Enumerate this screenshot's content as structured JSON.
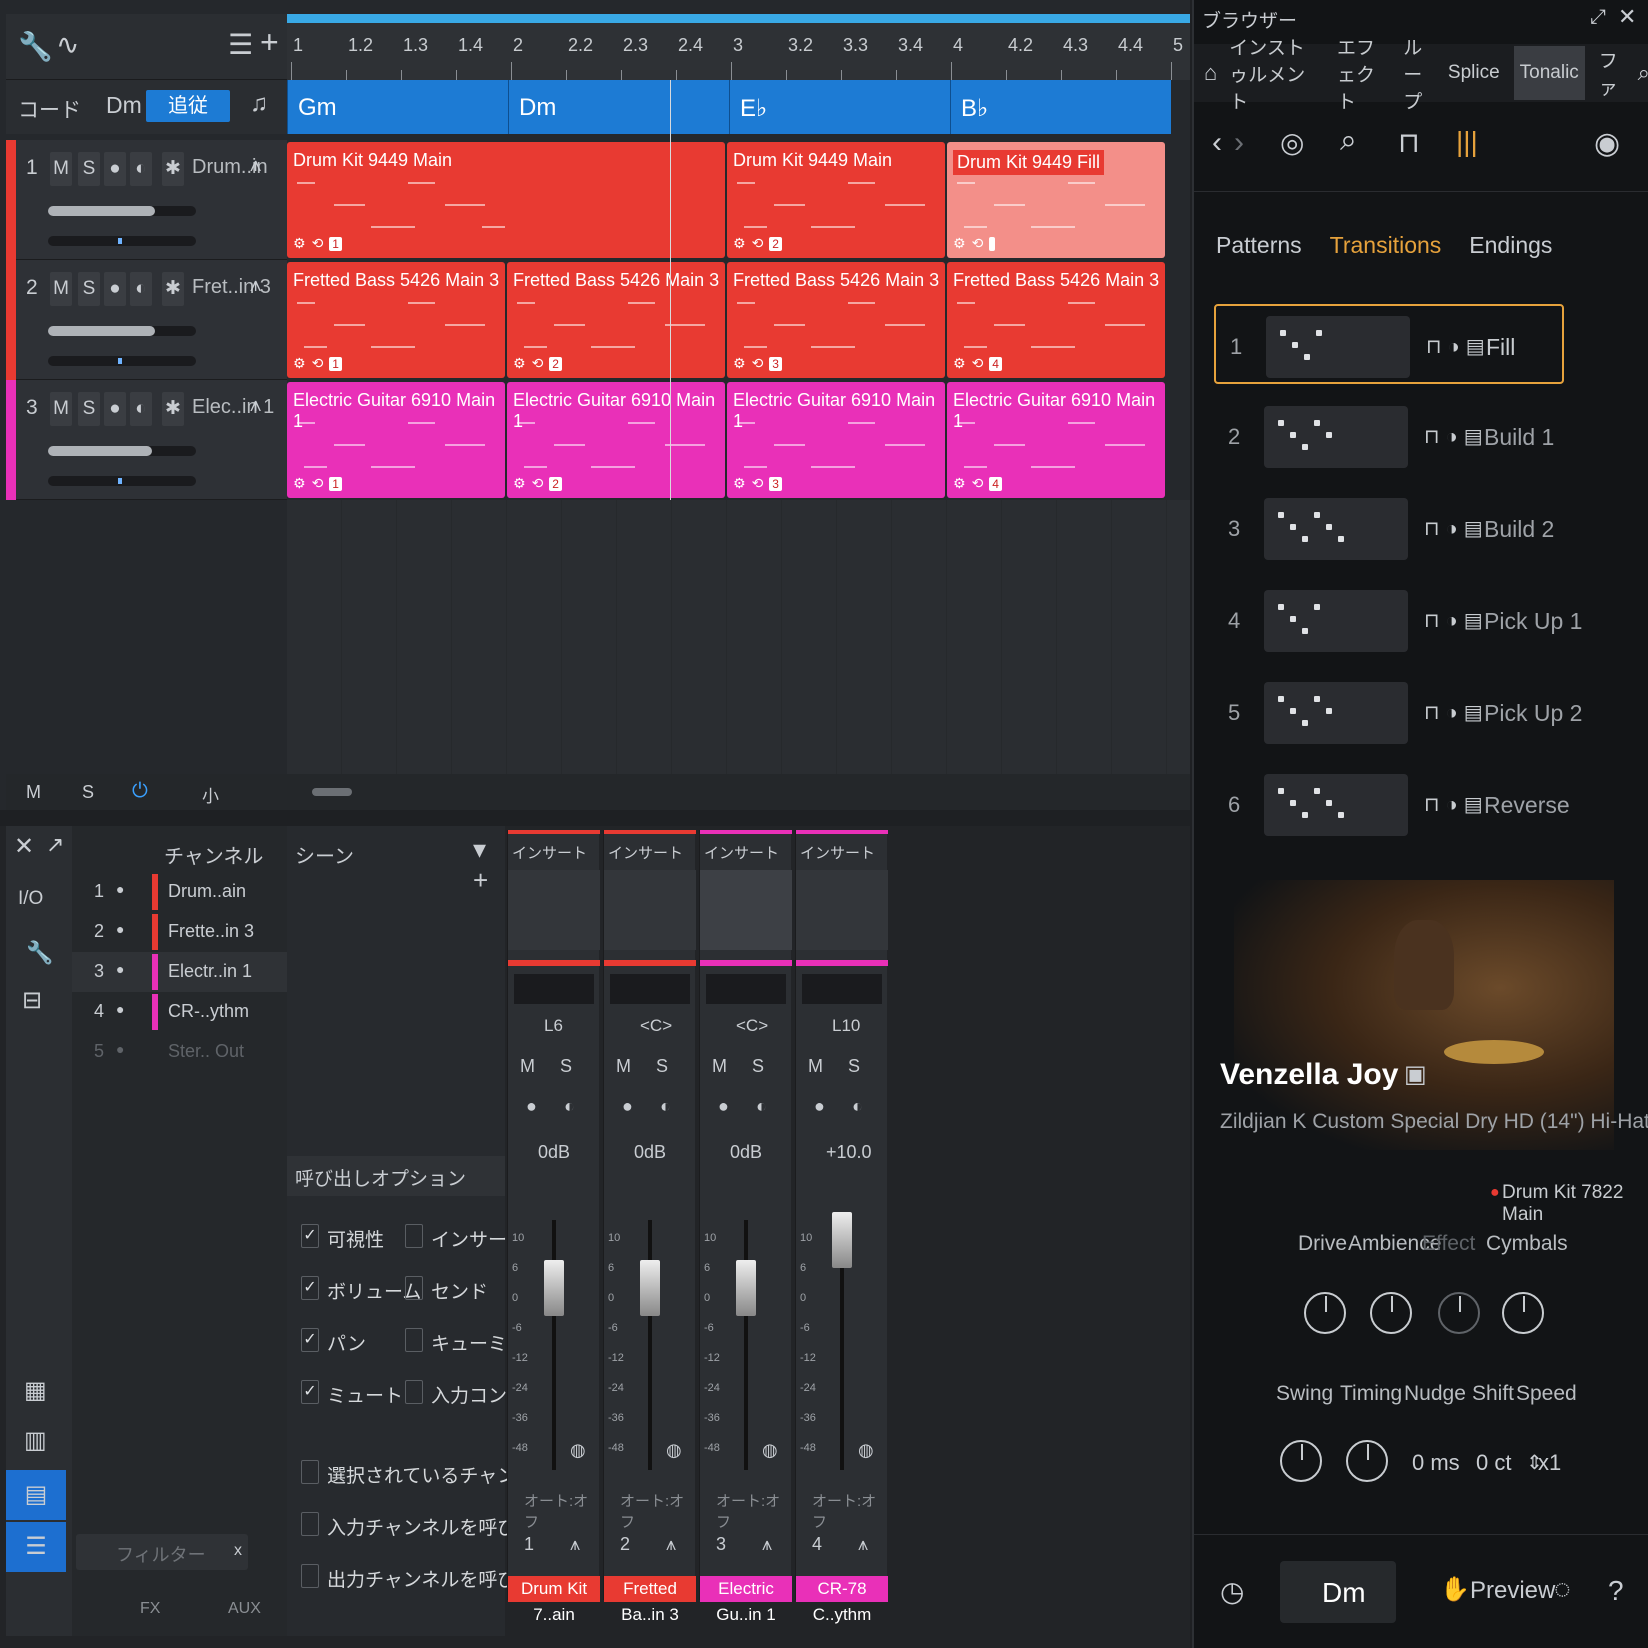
{
  "arrange": {
    "ruler_marks": [
      "1",
      "1.2",
      "1.3",
      "1.4",
      "2",
      "2.2",
      "2.3",
      "2.4",
      "3",
      "3.2",
      "3.3",
      "3.4",
      "4",
      "4.2",
      "4.3",
      "4.4",
      "5"
    ],
    "chord_header": {
      "label": "コード",
      "key": "Dm",
      "follow_button": "追従"
    },
    "chords": [
      "Gm",
      "Dm",
      "E♭",
      "B♭"
    ],
    "tracks": [
      {
        "num": "1",
        "name": "Drum..in",
        "color": "#e83a32",
        "clips": [
          {
            "title": "Drum Kit 9449 Main",
            "badge": "1"
          },
          {
            "title": "Drum Kit 9449 Main",
            "badge": "2"
          },
          {
            "title": "Drum Kit 9449 Fill",
            "badge": ""
          }
        ]
      },
      {
        "num": "2",
        "name": "Fret..in 3",
        "color": "#e83a32",
        "clips": [
          {
            "title": "Fretted Bass 5426 Main 3",
            "badge": "1"
          },
          {
            "title": "Fretted Bass 5426 Main 3",
            "badge": "2"
          },
          {
            "title": "Fretted Bass 5426 Main 3",
            "badge": "3"
          },
          {
            "title": "Fretted Bass 5426 Main 3",
            "badge": "4"
          }
        ]
      },
      {
        "num": "3",
        "name": "Elec..in 1",
        "color": "#e930b8",
        "clips": [
          {
            "title": "Electric Guitar 6910 Main 1",
            "badge": "1"
          },
          {
            "title": "Electric Guitar 6910 Main 1",
            "badge": "2"
          },
          {
            "title": "Electric Guitar 6910 Main 1",
            "badge": "3"
          },
          {
            "title": "Electric Guitar 6910 Main 1",
            "badge": "4"
          }
        ]
      }
    ],
    "footer": {
      "m": "M",
      "s": "S",
      "size": "小"
    }
  },
  "mixer": {
    "left_labels": {
      "io": "I/O"
    },
    "channel_header": "チャンネル",
    "channels": [
      {
        "num": "1",
        "name": "Drum..ain",
        "color": "#e83a32"
      },
      {
        "num": "2",
        "name": "Frette..in 3",
        "color": "#e83a32"
      },
      {
        "num": "3",
        "name": "Electr..in 1",
        "color": "#e930b8"
      },
      {
        "num": "4",
        "name": "CR-..ythm",
        "color": "#e930b8"
      },
      {
        "num": "5",
        "name": "Ster.. Out",
        "color": ""
      }
    ],
    "scene_header": "シーン",
    "recall_title": "呼び出しオプション",
    "options": [
      {
        "label": "可視性",
        "checked": true
      },
      {
        "label": "インサート",
        "checked": false
      },
      {
        "label": "ボリューム",
        "checked": true
      },
      {
        "label": "センド",
        "checked": false
      },
      {
        "label": "パン",
        "checked": true
      },
      {
        "label": "キューミックス",
        "checked": false
      },
      {
        "label": "ミュート",
        "checked": true
      },
      {
        "label": "入力コントロー",
        "checked": false
      }
    ],
    "bottom_options": [
      "選択されているチャンネルのみ",
      "入力チャンネルを呼び出す",
      "出力チャンネルを呼び出す"
    ],
    "filter_placeholder": "フィルター",
    "bottom_tabs": [
      "FX",
      "AUX"
    ],
    "strips": [
      {
        "insert": "インサート",
        "pan": "L6",
        "db": "0dB",
        "auto": "オート:オフ",
        "num": "1",
        "name": "Drum Kit 7..ain",
        "color": "#e83a32"
      },
      {
        "insert": "インサート",
        "pan": "<C>",
        "db": "0dB",
        "auto": "オート:オフ",
        "num": "2",
        "name": "Fretted Ba..in 3",
        "color": "#e83a32"
      },
      {
        "insert": "インサート",
        "pan": "<C>",
        "db": "0dB",
        "auto": "オート:オフ",
        "num": "3",
        "name": "Electric Gu..in 1",
        "color": "#e930b8"
      },
      {
        "insert": "インサート",
        "pan": "L10",
        "db": "+10.0",
        "auto": "オート:オフ",
        "num": "4",
        "name": "CR-78 C..ythm",
        "color": "#e930b8"
      }
    ],
    "scale": [
      "10",
      "6",
      "0",
      "-6",
      "-12",
      "-24",
      "-36",
      "-48"
    ]
  },
  "browser": {
    "title": "ブラウザー",
    "tabs": [
      "インストゥルメント",
      "エフェクト",
      "ループ",
      "Splice",
      "Tonalic",
      "ファ"
    ],
    "subtabs": [
      "Patterns",
      "Transitions",
      "Endings"
    ],
    "patterns": [
      {
        "num": "1",
        "name": "Fill"
      },
      {
        "num": "2",
        "name": "Build 1"
      },
      {
        "num": "3",
        "name": "Build 2"
      },
      {
        "num": "4",
        "name": "Pick Up 1"
      },
      {
        "num": "5",
        "name": "Pick Up 2"
      },
      {
        "num": "6",
        "name": "Reverse"
      }
    ],
    "artist": "Venzella Joy",
    "instrument": "Zildjian K Custom Special Dry HD (14\") Hi-Hat",
    "kit": "Drum Kit 7822 Main",
    "knobs1": [
      "Drive",
      "Ambience",
      "Effect",
      "Cymbals"
    ],
    "knobs2": [
      "Swing",
      "Timing",
      "Nudge",
      "Shift",
      "Speed"
    ],
    "values": {
      "nudge": "0 ms",
      "shift": "0 ct",
      "speed": "x1"
    },
    "footer": {
      "key": "Dm",
      "preview": "Preview",
      "help": "?"
    },
    "accent": "#e6a23c"
  }
}
